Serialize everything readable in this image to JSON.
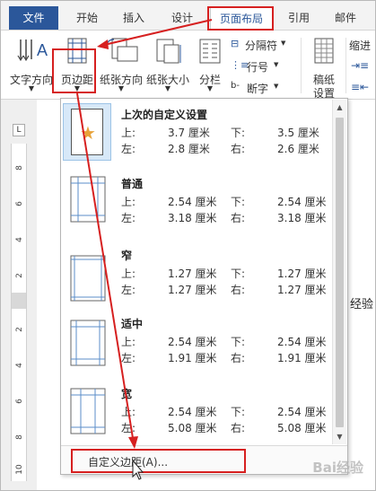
{
  "tabs": {
    "file": "文件",
    "start": "开始",
    "insert": "插入",
    "design": "设计",
    "page_layout": "页面布局",
    "references": "引用",
    "mail": "邮件"
  },
  "ribbon": {
    "text_direction": "文字方向",
    "margins": "页边距",
    "orientation": "纸张方向",
    "size": "纸张大小",
    "columns": "分栏",
    "breaks": "分隔符",
    "line_numbers": "行号",
    "hyphenation": "断字",
    "manuscript_line1": "稿纸",
    "manuscript_line2": "设置",
    "indent": "缩进"
  },
  "ruler": {
    "corner": "L",
    "numbers": [
      "8",
      "6",
      "4",
      "2",
      "2",
      "4",
      "6",
      "8",
      "10"
    ]
  },
  "document": {
    "partial_text": "经验"
  },
  "margins_menu": {
    "items": [
      {
        "name": "上次的自定义设置",
        "top_label": "上:",
        "top": "3.7 厘米",
        "bottom_label": "下:",
        "bottom": "3.5 厘米",
        "left_label": "左:",
        "left": "2.8 厘米",
        "right_label": "右:",
        "right": "2.6 厘米"
      },
      {
        "name": "普通",
        "top_label": "上:",
        "top": "2.54 厘米",
        "bottom_label": "下:",
        "bottom": "2.54 厘米",
        "left_label": "左:",
        "left": "3.18 厘米",
        "right_label": "右:",
        "right": "3.18 厘米"
      },
      {
        "name": "窄",
        "top_label": "上:",
        "top": "1.27 厘米",
        "bottom_label": "下:",
        "bottom": "1.27 厘米",
        "left_label": "左:",
        "left": "1.27 厘米",
        "right_label": "右:",
        "right": "1.27 厘米"
      },
      {
        "name": "适中",
        "top_label": "上:",
        "top": "2.54 厘米",
        "bottom_label": "下:",
        "bottom": "2.54 厘米",
        "left_label": "左:",
        "left": "1.91 厘米",
        "right_label": "右:",
        "right": "1.91 厘米"
      },
      {
        "name": "宽",
        "top_label": "上:",
        "top": "2.54 厘米",
        "bottom_label": "下:",
        "bottom": "2.54 厘米",
        "left_label": "左:",
        "left": "5.08 厘米",
        "right_label": "右:",
        "right": "5.08 厘米"
      }
    ],
    "custom_margins": "自定义边距(A)..."
  },
  "watermark": "Bai经验",
  "colors": {
    "file_tab": "#2b579a",
    "highlight": "#d62020",
    "selected_thumb": "#d7e8f8"
  }
}
